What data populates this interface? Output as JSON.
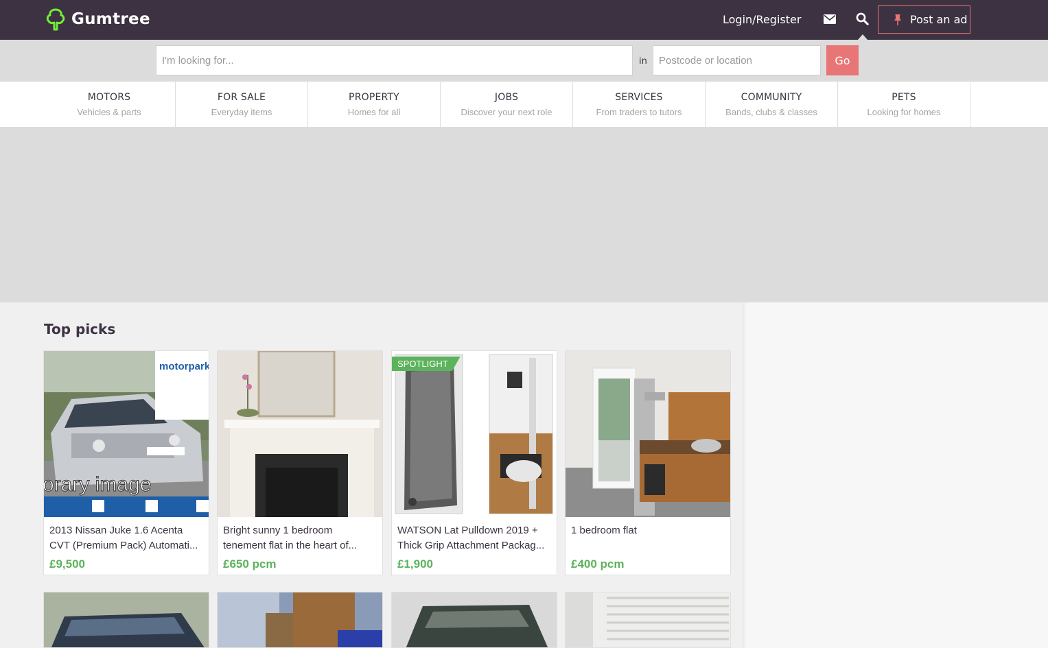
{
  "header": {
    "logo_text": "Gumtree",
    "login_label": "Login/Register",
    "post_ad_label": "Post an ad",
    "colors": {
      "bar": "#3c3241",
      "accent": "#e87676",
      "logo_green": "#72ef36"
    }
  },
  "search": {
    "query_placeholder": "I'm looking for...",
    "in_label": "in",
    "location_placeholder": "Postcode or location",
    "go_label": "Go"
  },
  "categories": [
    {
      "title": "MOTORS",
      "subtitle": "Vehicles & parts"
    },
    {
      "title": "FOR SALE",
      "subtitle": "Everyday items"
    },
    {
      "title": "PROPERTY",
      "subtitle": "Homes for all"
    },
    {
      "title": "JOBS",
      "subtitle": "Discover your next role"
    },
    {
      "title": "SERVICES",
      "subtitle": "From traders to tutors"
    },
    {
      "title": "COMMUNITY",
      "subtitle": "Bands, clubs & classes"
    },
    {
      "title": "PETS",
      "subtitle": "Looking for homes"
    }
  ],
  "top_picks": {
    "title": "Top picks",
    "listings": [
      {
        "title": "2013 Nissan Juke 1.6 Acenta CVT (Premium Pack) Automati...",
        "price": "£9,500",
        "image_overlay": "orary image",
        "image_brand": "motorpark"
      },
      {
        "title": "Bright sunny 1 bedroom tenement flat in the heart of...",
        "price": "£650 pcm"
      },
      {
        "title": "WATSON Lat Pulldown 2019 + Thick Grip Attachment Packag...",
        "price": "£1,900",
        "badge": "SPOTLIGHT"
      },
      {
        "title": "1 bedroom flat",
        "price": "£400 pcm"
      }
    ]
  }
}
